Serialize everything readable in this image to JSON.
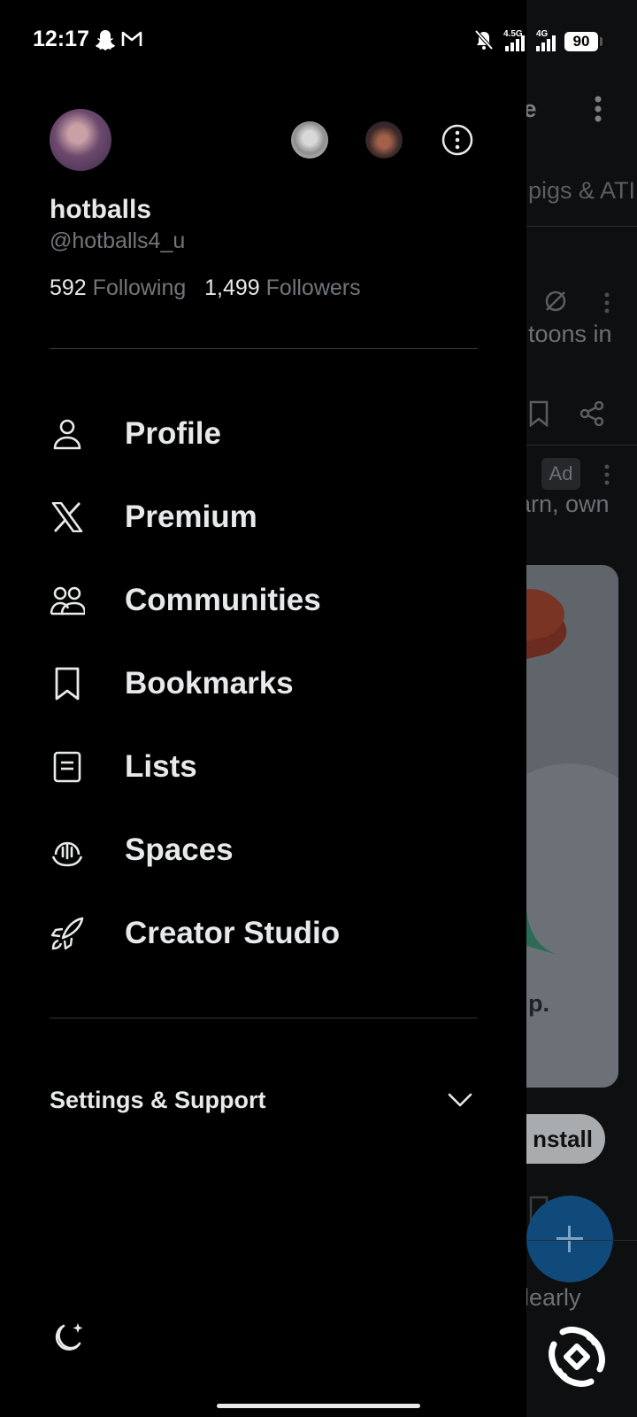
{
  "status_bar": {
    "time": "12:17",
    "net_1": "4.5G",
    "net_2": "4G",
    "battery": "90",
    "icons": [
      "snapchat-icon",
      "gmail-icon",
      "bell-muted-icon",
      "signal-icon",
      "signal-icon",
      "battery-icon"
    ]
  },
  "profile": {
    "display_name": "hotballs",
    "handle": "@hotballs4_u",
    "following_count": "592",
    "following_label": "Following",
    "followers_count": "1,499",
    "followers_label": "Followers"
  },
  "nav": {
    "items": [
      {
        "label": "Profile",
        "icon": "person-icon"
      },
      {
        "label": "Premium",
        "icon": "x-logo-icon"
      },
      {
        "label": "Communities",
        "icon": "communities-icon"
      },
      {
        "label": "Bookmarks",
        "icon": "bookmark-icon"
      },
      {
        "label": "Lists",
        "icon": "list-icon"
      },
      {
        "label": "Spaces",
        "icon": "spaces-icon"
      },
      {
        "label": "Creator Studio",
        "icon": "rocket-icon"
      }
    ]
  },
  "settings": {
    "label": "Settings & Support"
  },
  "background_feed": {
    "header_fragment": "ade",
    "tab_fragment": "pigs & ATI",
    "post_fragment_1": "toons in",
    "ad_badge": "Ad",
    "post_fragment_2": "arn, own",
    "ad_cta_fragment": "p.",
    "install_fragment": "nstall",
    "post_fragment_3": "learly"
  },
  "colors": {
    "background": "#000000",
    "text_primary": "#e7e9ea",
    "text_secondary": "#71767b",
    "divider": "#2f3336",
    "fab": "#0f4a7a"
  }
}
